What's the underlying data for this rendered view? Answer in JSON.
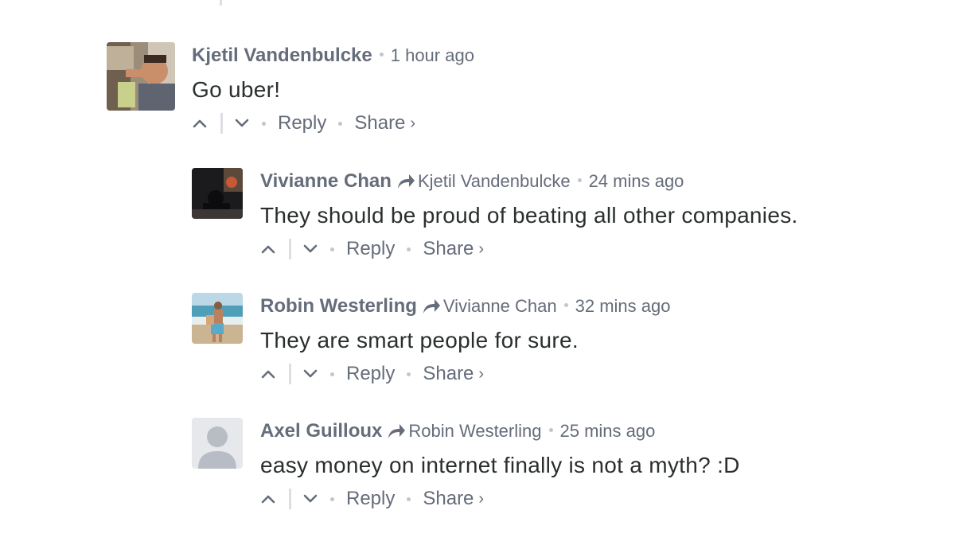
{
  "comments": [
    {
      "author": "Kjetil Vandenbulcke",
      "reply_to": "",
      "time": "1 hour ago",
      "text": "Go uber!",
      "reply_label": "Reply",
      "share_label": "Share",
      "chevron": "›"
    },
    {
      "author": "Vivianne Chan",
      "reply_to": "Kjetil Vandenbulcke",
      "time": "24 mins ago",
      "text": "They should be proud of beating all other companies.",
      "reply_label": "Reply",
      "share_label": "Share",
      "chevron": "›"
    },
    {
      "author": "Robin Westerling",
      "reply_to": "Vivianne Chan",
      "time": "32 mins ago",
      "text": "They are smart people for sure.",
      "reply_label": "Reply",
      "share_label": "Share",
      "chevron": "›"
    },
    {
      "author": "Axel Guilloux",
      "reply_to": "Robin Westerling",
      "time": "25 mins ago",
      "text": "easy money on internet finally is not a myth? :D",
      "reply_label": "Reply",
      "share_label": "Share",
      "chevron": "›"
    }
  ],
  "colors": {
    "meta_text": "#656c7a",
    "body_text": "#2a2e2e",
    "separator": "#dbdfe4"
  },
  "icons": [
    "upvote-icon",
    "downvote-icon",
    "reply-arrow-icon",
    "default-avatar-icon"
  ]
}
